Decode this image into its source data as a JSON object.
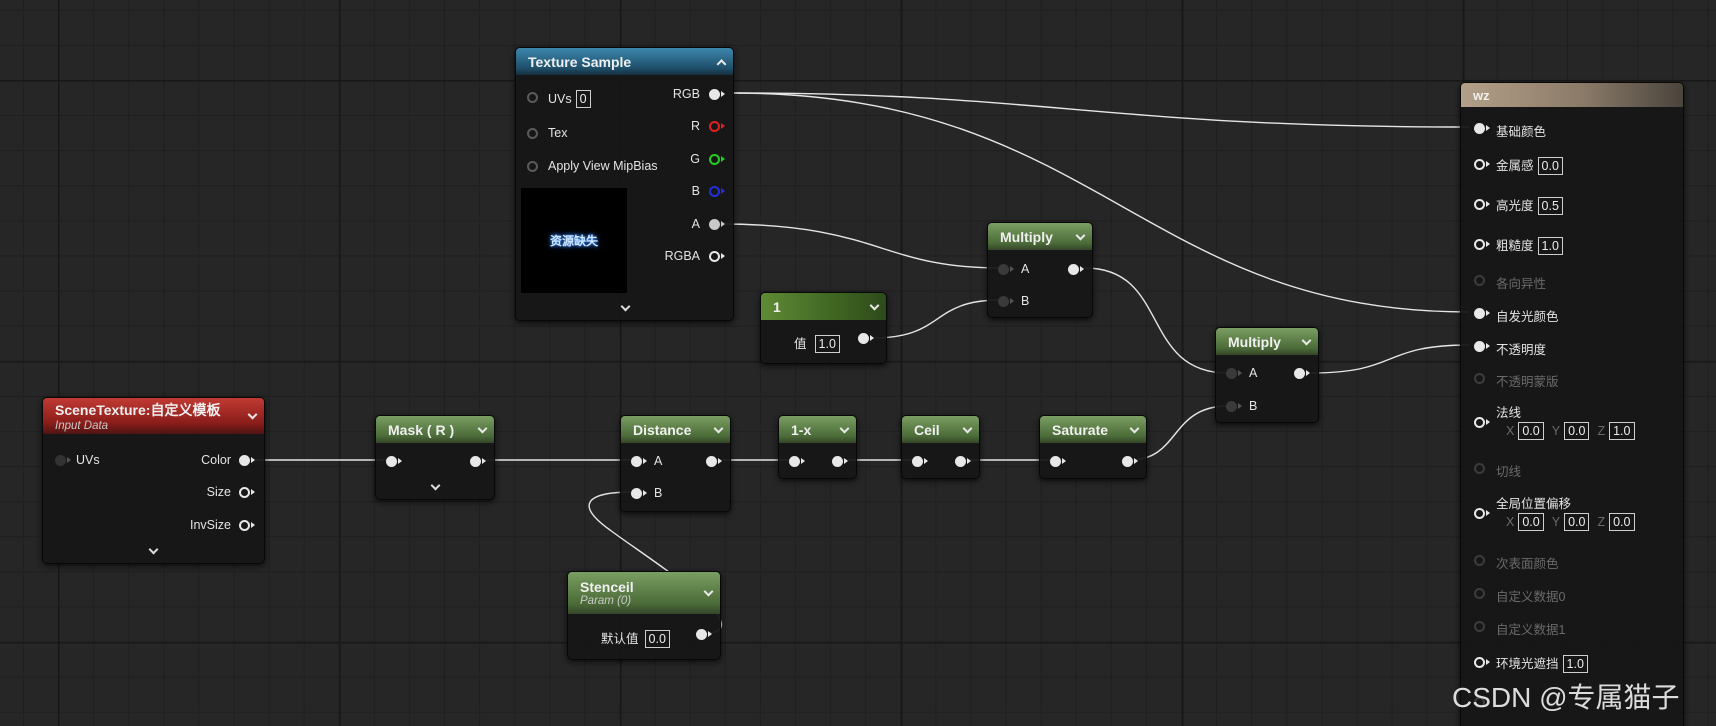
{
  "texture_sample": {
    "title": "Texture Sample",
    "uvs_label": "UVs",
    "uvs_value": "0",
    "tex_label": "Tex",
    "mipbias_label": "Apply View MipBias",
    "outputs": [
      "RGB",
      "R",
      "G",
      "B",
      "A",
      "RGBA"
    ],
    "preview_text": "资源缺失"
  },
  "scene_texture": {
    "title": "SceneTexture:自定义模板",
    "subtitle": "Input Data",
    "uvs_label": "UVs",
    "outputs": [
      "Color",
      "Size",
      "InvSize"
    ]
  },
  "mask_node": {
    "title": "Mask ( R )"
  },
  "distance_node": {
    "title": "Distance",
    "inputs": [
      "A",
      "B"
    ]
  },
  "one_minus_node": {
    "title": "1-x"
  },
  "ceil_node": {
    "title": "Ceil"
  },
  "saturate_node": {
    "title": "Saturate"
  },
  "multiply1": {
    "title": "Multiply",
    "inputs": [
      "A",
      "B"
    ]
  },
  "multiply2": {
    "title": "Multiply",
    "inputs": [
      "A",
      "B"
    ]
  },
  "constant_node": {
    "title": "1",
    "value_label": "值",
    "value": "1.0"
  },
  "stencil_node": {
    "title": "Stenceil",
    "subtitle": "Param (0)",
    "default_label": "默认值",
    "default_value": "0.0"
  },
  "material": {
    "title": "wz",
    "base_color": "基础颜色",
    "metallic": "金属感",
    "metallic_value": "0.0",
    "specular": "高光度",
    "specular_value": "0.5",
    "roughness": "粗糙度",
    "roughness_value": "1.0",
    "anisotropy": "各向异性",
    "emissive": "自发光颜色",
    "opacity": "不透明度",
    "opacity_mask": "不透明蒙版",
    "normal": "法线",
    "normal_x": "0.0",
    "normal_y": "0.0",
    "normal_z": "1.0",
    "tangent": "切线",
    "wpo": "全局位置偏移",
    "wpo_x": "0.0",
    "wpo_y": "0.0",
    "wpo_z": "0.0",
    "subsurface": "次表面颜色",
    "custom0": "自定义数据0",
    "custom1": "自定义数据1",
    "ao": "环境光遮挡",
    "ao_value": "1.0",
    "axis_x": "X",
    "axis_y": "Y",
    "axis_z": "Z"
  },
  "watermark": "CSDN @专属猫子",
  "colors": {
    "r_pin": "#e02020",
    "g_pin": "#20d020",
    "b_pin": "#2030e0",
    "a_pin": "#c8c8c8"
  }
}
